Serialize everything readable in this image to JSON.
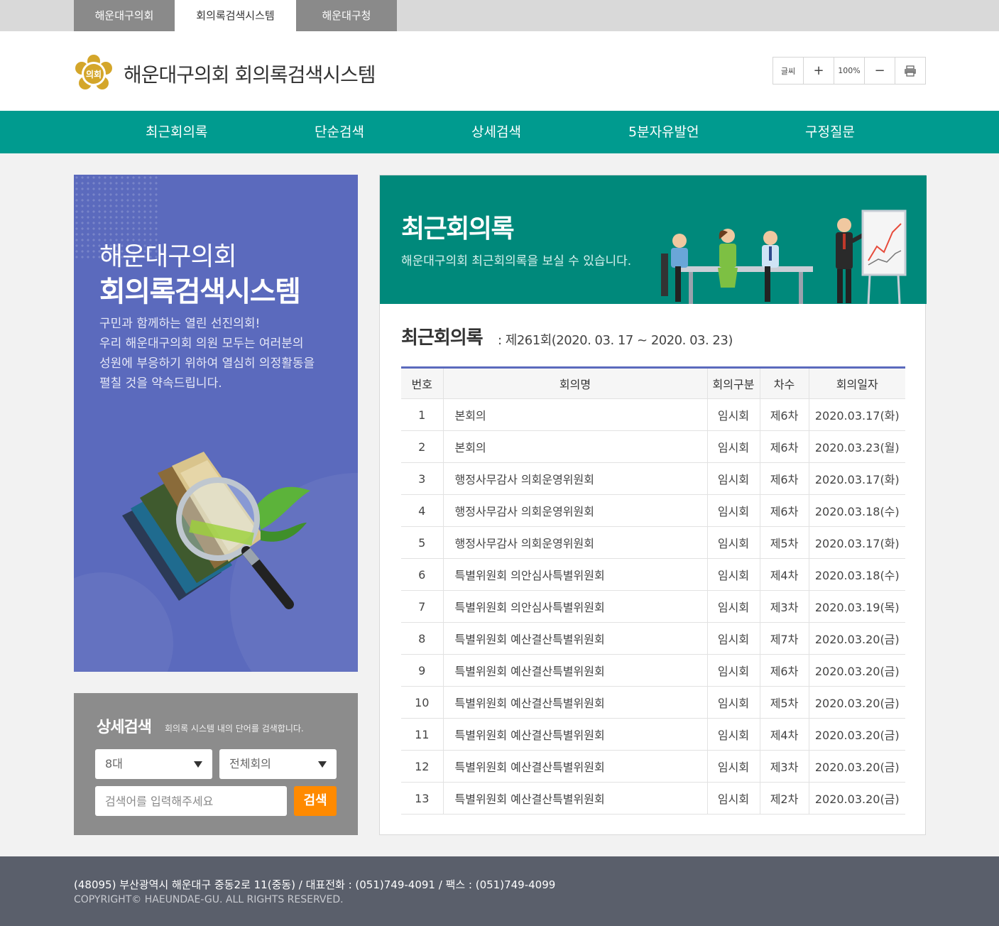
{
  "top_tabs": [
    "해운대구의회",
    "회의록검색시스템",
    "해운대구청"
  ],
  "header": {
    "emblem_text": "의회",
    "title": "해운대구의회 회의록검색시스템",
    "font_controls": {
      "label": "글씨",
      "plus": "+",
      "zoom": "100%",
      "minus": "−"
    }
  },
  "nav": [
    "최근회의록",
    "단순검색",
    "상세검색",
    "5분자유발언",
    "구정질문"
  ],
  "promo": {
    "title1": "해운대구의회",
    "title2": "회의록검색시스템",
    "desc": [
      "구민과 함께하는 열린 선진의회!",
      "우리 해운대구의회 의원 모두는 여러분의",
      "성원에 부응하기 위하여 열심히 의정활동을",
      "펼칠 것을 약속드립니다."
    ]
  },
  "detail_search": {
    "title": "상세검색",
    "subtitle": "회의록 시스템 내의 단어를 검색합니다.",
    "select_term": "8대",
    "select_meeting": "전체회의",
    "placeholder": "검색어를 입력해주세요",
    "button": "검색"
  },
  "banner": {
    "title": "최근회의록",
    "subtitle": "해운대구의회 최근회의록을 보실 수 있습니다."
  },
  "section": {
    "title": "최근회의록",
    "session": ": 제261회(2020. 03. 17 ~ 2020. 03. 23)"
  },
  "table": {
    "headers": [
      "번호",
      "회의명",
      "회의구분",
      "차수",
      "회의일자"
    ],
    "rows": [
      [
        "1",
        "본회의",
        "임시회",
        "제6차",
        "2020.03.17(화)"
      ],
      [
        "2",
        "본회의",
        "임시회",
        "제6차",
        "2020.03.23(월)"
      ],
      [
        "3",
        "행정사무감사 의회운영위원회",
        "임시회",
        "제6차",
        "2020.03.17(화)"
      ],
      [
        "4",
        "행정사무감사 의회운영위원회",
        "임시회",
        "제6차",
        "2020.03.18(수)"
      ],
      [
        "5",
        "행정사무감사 의회운영위원회",
        "임시회",
        "제5차",
        "2020.03.17(화)"
      ],
      [
        "6",
        "특별위원회 의안심사특별위원회",
        "임시회",
        "제4차",
        "2020.03.18(수)"
      ],
      [
        "7",
        "특별위원회 의안심사특별위원회",
        "임시회",
        "제3차",
        "2020.03.19(목)"
      ],
      [
        "8",
        "특별위원회 예산결산특별위원회",
        "임시회",
        "제7차",
        "2020.03.20(금)"
      ],
      [
        "9",
        "특별위원회 예산결산특별위원회",
        "임시회",
        "제6차",
        "2020.03.20(금)"
      ],
      [
        "10",
        "특별위원회 예산결산특별위원회",
        "임시회",
        "제5차",
        "2020.03.20(금)"
      ],
      [
        "11",
        "특별위원회 예산결산특별위원회",
        "임시회",
        "제4차",
        "2020.03.20(금)"
      ],
      [
        "12",
        "특별위원회 예산결산특별위원회",
        "임시회",
        "제3차",
        "2020.03.20(금)"
      ],
      [
        "13",
        "특별위원회 예산결산특별위원회",
        "임시회",
        "제2차",
        "2020.03.20(금)"
      ]
    ]
  },
  "footer": {
    "address": "(48095) 부산광역시 해운대구 중동2로 11(중동) / 대표전화 : (051)749-4091 / 팩스 : (051)749-4099",
    "copyright": "COPYRIGHT© HAEUNDAE-GU. ALL RIGHTS RESERVED."
  },
  "colors": {
    "teal": "#009b8f",
    "indigo": "#5b6abd",
    "orange": "#ff8a00",
    "footer": "#5a5f6b"
  },
  "icons": [
    "emblem-icon",
    "print-icon",
    "dropdown-arrow-icon",
    "books-magnifier-illustration",
    "meeting-illustration"
  ]
}
